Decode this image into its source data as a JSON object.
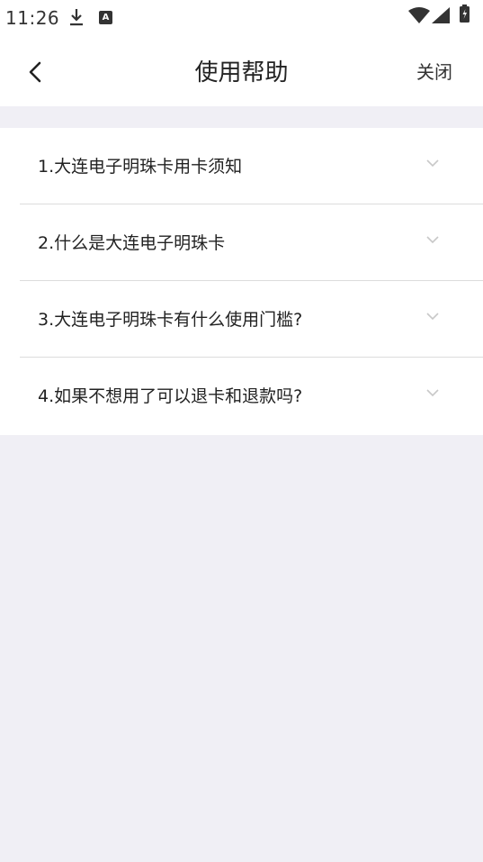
{
  "status_bar": {
    "time": "11:26",
    "icons": [
      "download-icon",
      "a-icon",
      "wifi-icon",
      "signal-icon",
      "battery-icon"
    ],
    "a_icon_letter": "A"
  },
  "nav": {
    "title": "使用帮助",
    "close_label": "关闭",
    "back_icon": "chevron-left-icon"
  },
  "faq": {
    "items": [
      {
        "label": "1.大连电子明珠卡用卡须知"
      },
      {
        "label": "2.什么是大连电子明珠卡"
      },
      {
        "label": "3.大连电子明珠卡有什么使用门槛?"
      },
      {
        "label": "4.如果不想用了可以退卡和退款吗?"
      }
    ],
    "chevron_icon": "chevron-down-icon"
  },
  "colors": {
    "background": "#f0eff5",
    "surface": "#ffffff",
    "divider": "#dcdcdc",
    "text": "#222222",
    "chevron": "#c8c8c8"
  }
}
